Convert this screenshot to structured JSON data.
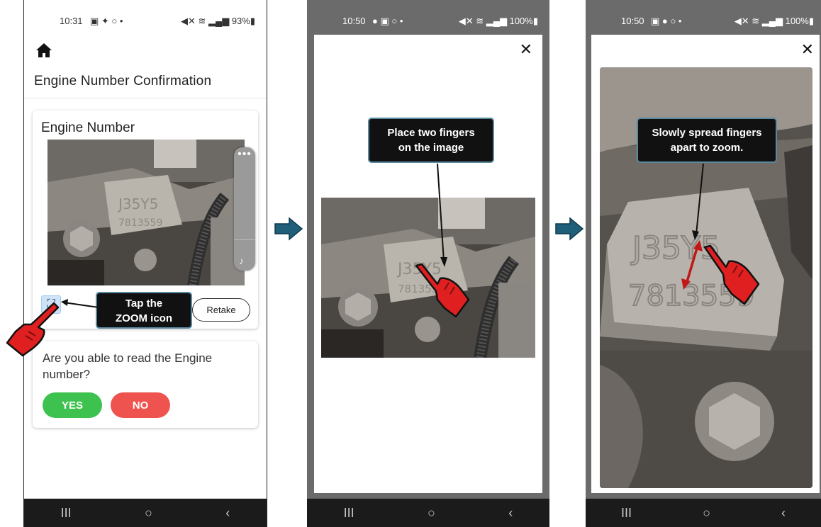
{
  "panels": [
    {
      "status": {
        "time": "10:31",
        "icons": "▣ ✦ ○ •",
        "right": "◀✕ ≋ ▂▄▆ 93%▮"
      },
      "header_title": "Engine Number Confirmation",
      "card_title": "Engine Number",
      "retake_label": "Retake",
      "callout": {
        "line1": "Tap the",
        "line2": "ZOOM icon"
      },
      "question": "Are you able to read the Engine number?",
      "yes_label": "YES",
      "no_label": "NO"
    },
    {
      "status": {
        "time": "10:50",
        "icons": "● ▣ ○ •",
        "right": "◀✕ ≋ ▂▄▆ 100%▮"
      },
      "callout": {
        "line1": "Place two fingers",
        "line2": "on the image"
      }
    },
    {
      "status": {
        "time": "10:50",
        "icons": "▣ ● ○ •",
        "right": "◀✕ ≋ ▂▄▆ 100%▮"
      },
      "callout": {
        "line1": "Slowly spread fingers",
        "line2": "apart to zoom."
      }
    }
  ],
  "nav": {
    "recents": "III",
    "home": "○",
    "back": "‹"
  },
  "engine_stamp": {
    "line1": "J35Y5",
    "line2": "7813559"
  },
  "colors": {
    "yes": "#3ec24f",
    "no": "#ef5350",
    "hand": "#e02020",
    "step_arrow": "#1f5f7a",
    "frame": "#6b6b6b"
  },
  "icons": [
    "home-icon",
    "zoom-icon",
    "close-icon",
    "hand-pointer-icon",
    "step-arrow-icon",
    "spread-arrow-icon"
  ]
}
